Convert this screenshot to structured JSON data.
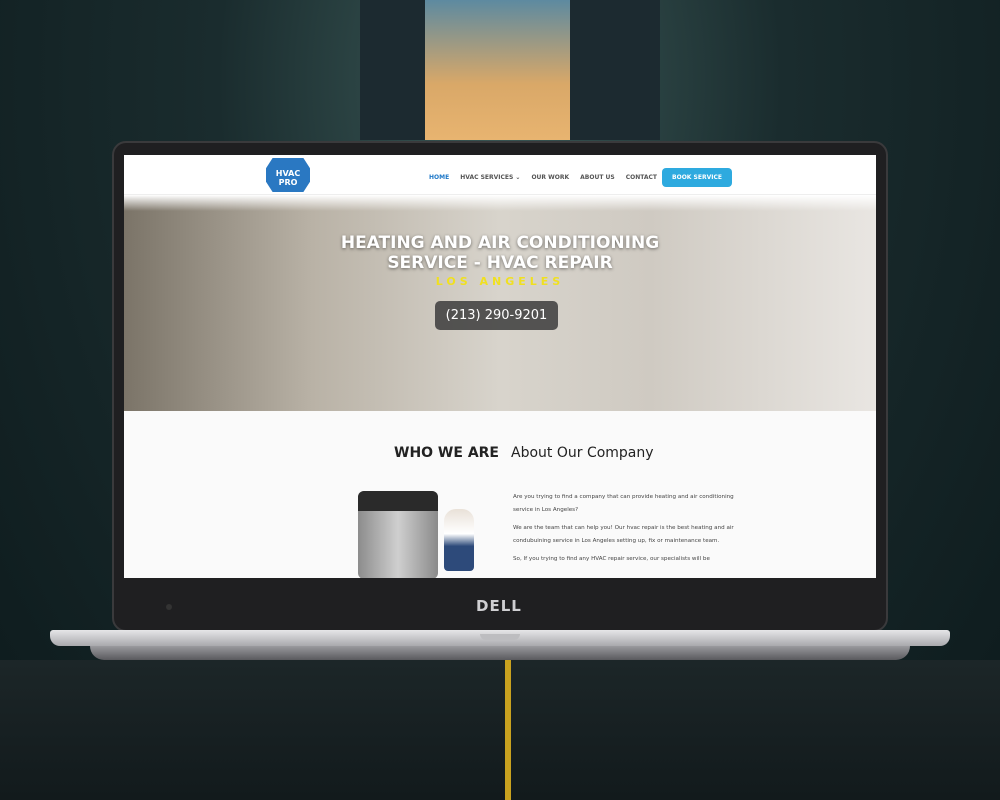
{
  "device": {
    "brand": "DELL"
  },
  "nav": {
    "logo_text": "HVAC PRO",
    "items": [
      "HOME",
      "HVAC SERVICES ⌄",
      "OUR WORK",
      "ABOUT US",
      "CONTACT"
    ],
    "cta": "BOOK SERVICE"
  },
  "hero": {
    "title_line1": "HEATING AND AIR CONDITIONING",
    "title_line2": "SERVICE - HVAC REPAIR",
    "subtitle": "LOS ANGELES",
    "phone": "(213) 290-9201"
  },
  "about": {
    "heading_bold": "WHO WE ARE",
    "heading": "About Our Company",
    "paragraphs": [
      "Are you trying to find a company that can provide heating and air conditioning service in Los Angeles?",
      "We are the team that can help you! Our hvac repair is the best heating and air condubuining service in Los Angeles setting up, fix or maintenance team.",
      "So, If you trying to find any HVAC repair service, our specialists will be"
    ]
  }
}
